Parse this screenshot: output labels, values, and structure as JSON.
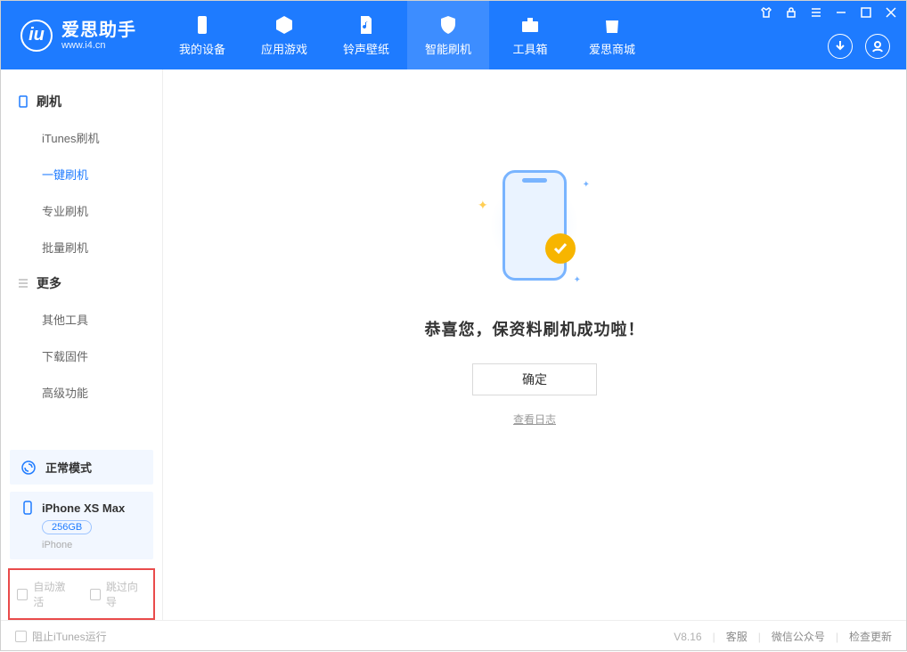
{
  "app": {
    "title": "爱思助手",
    "site": "www.i4.cn"
  },
  "tabs": {
    "device": "我的设备",
    "apps": "应用游戏",
    "ring": "铃声壁纸",
    "flash": "智能刷机",
    "tools": "工具箱",
    "store": "爱思商城"
  },
  "sidebar": {
    "section_flash": "刷机",
    "items_flash": {
      "itunes": "iTunes刷机",
      "oneclick": "一键刷机",
      "pro": "专业刷机",
      "batch": "批量刷机"
    },
    "section_more": "更多",
    "items_more": {
      "other": "其他工具",
      "fw": "下载固件",
      "adv": "高级功能"
    }
  },
  "mode": {
    "label": "正常模式"
  },
  "device": {
    "name": "iPhone XS Max",
    "capacity": "256GB",
    "type": "iPhone"
  },
  "options": {
    "auto_activate": "自动激活",
    "skip_guide": "跳过向导"
  },
  "main": {
    "message": "恭喜您，保资料刷机成功啦！",
    "ok": "确定",
    "log": "查看日志"
  },
  "footer": {
    "block_itunes": "阻止iTunes运行",
    "version": "V8.16",
    "support": "客服",
    "wechat": "微信公众号",
    "update": "检查更新"
  }
}
